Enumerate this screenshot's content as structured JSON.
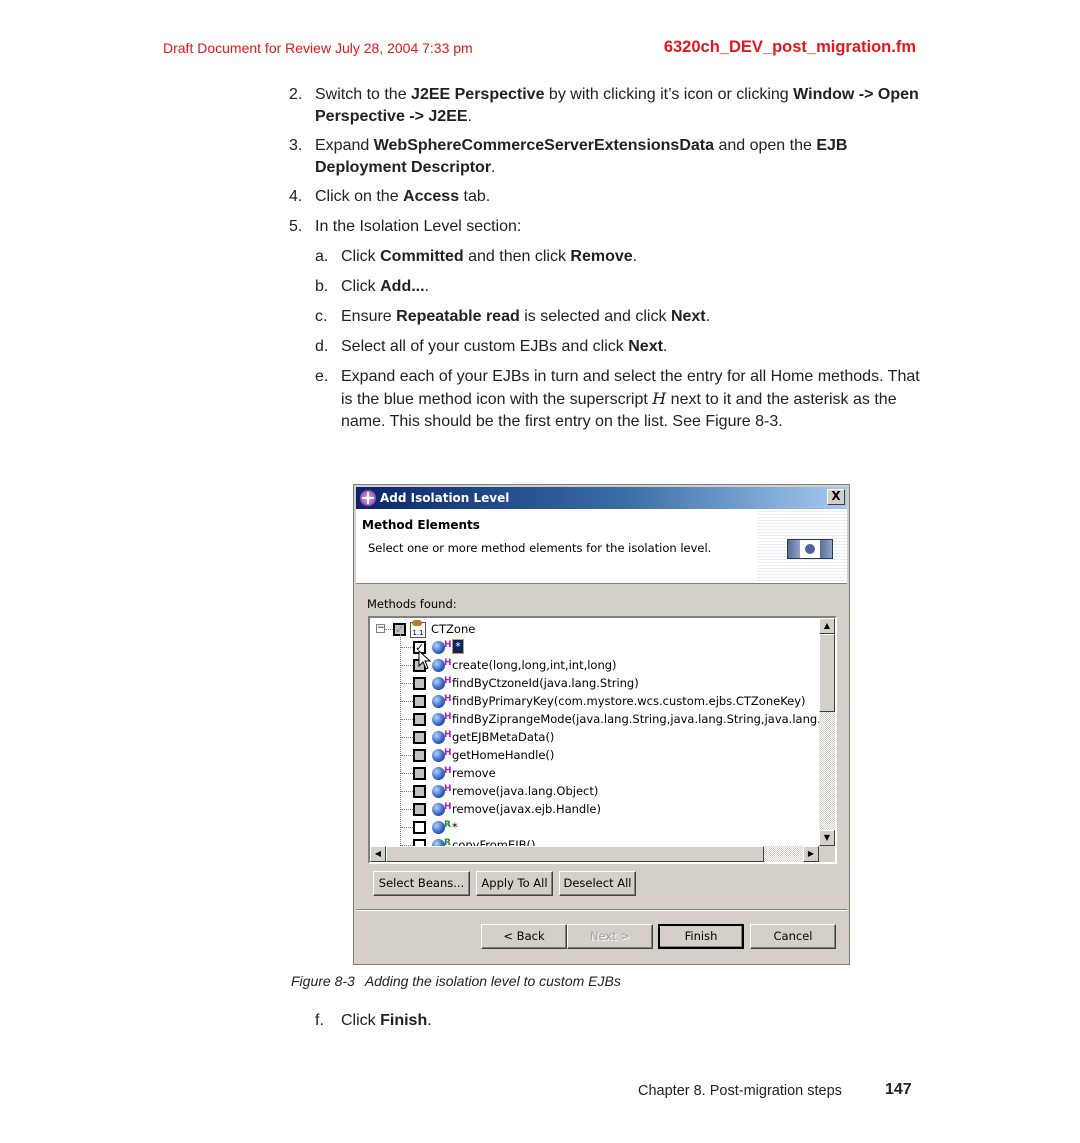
{
  "header": {
    "draft_notice": "Draft Document for Review July 28, 2004 7:33 pm",
    "filename": "6320ch_DEV_post_migration.fm"
  },
  "steps": [
    {
      "num": "2.",
      "parts": [
        {
          "t": "Switch to the ",
          "b": false
        },
        {
          "t": "J2EE Perspective",
          "b": true
        },
        {
          "t": " by with clicking it’s icon or clicking ",
          "b": false
        },
        {
          "t": "Window -> Open Perspective -> J2EE",
          "b": true
        },
        {
          "t": ".",
          "b": false
        }
      ]
    },
    {
      "num": "3.",
      "parts": [
        {
          "t": "Expand ",
          "b": false
        },
        {
          "t": "WebSphereCommerceServerExtensionsData",
          "b": true
        },
        {
          "t": " and open the ",
          "b": false
        },
        {
          "t": "EJB Deployment Descriptor",
          "b": true
        },
        {
          "t": ".",
          "b": false
        }
      ]
    },
    {
      "num": "4.",
      "parts": [
        {
          "t": "Click on the ",
          "b": false
        },
        {
          "t": "Access",
          "b": true
        },
        {
          "t": " tab.",
          "b": false
        }
      ]
    },
    {
      "num": "5.",
      "parts": [
        {
          "t": "In the Isolation Level section:",
          "b": false
        }
      ]
    }
  ],
  "substeps": [
    {
      "num": "a.",
      "parts": [
        {
          "t": "Click ",
          "b": false
        },
        {
          "t": "Committed",
          "b": true
        },
        {
          "t": " and then click ",
          "b": false
        },
        {
          "t": "Remove",
          "b": true
        },
        {
          "t": ".",
          "b": false
        }
      ]
    },
    {
      "num": "b.",
      "parts": [
        {
          "t": "Click ",
          "b": false
        },
        {
          "t": "Add...",
          "b": true
        },
        {
          "t": ".",
          "b": false
        }
      ]
    },
    {
      "num": "c.",
      "parts": [
        {
          "t": "Ensure ",
          "b": false
        },
        {
          "t": "Repeatable read",
          "b": true
        },
        {
          "t": " is selected and click ",
          "b": false
        },
        {
          "t": "Next",
          "b": true
        },
        {
          "t": ".",
          "b": false
        }
      ]
    },
    {
      "num": "d.",
      "parts": [
        {
          "t": "Select all of your custom EJBs and click ",
          "b": false
        },
        {
          "t": "Next",
          "b": true
        },
        {
          "t": ".",
          "b": false
        }
      ]
    },
    {
      "num": "e.",
      "parts": [
        {
          "t": "Expand each of your EJBs in turn and select the entry for all Home methods. That is the blue method icon with the superscript ",
          "b": false
        },
        {
          "t": "H",
          "i": true
        },
        {
          "t": " next to it and the asterisk as the name. This should be the first entry on the list. See Figure 8-3.",
          "b": false
        }
      ]
    }
  ],
  "dialog": {
    "title": "Add Isolation Level",
    "close_label": "X",
    "banner_title": "Method Elements",
    "banner_desc": "Select one or more method elements for the isolation level.",
    "methods_found_label": "Methods found:",
    "tree": {
      "root": {
        "label": "CTZone",
        "icon": "ejb-bean-icon",
        "icon_text": "1.1",
        "state": "grayed-checked",
        "expanded": true
      },
      "items": [
        {
          "label": "*",
          "type": "H",
          "checked": true,
          "selected": true
        },
        {
          "label": "create(long,long,int,int,long)",
          "type": "H",
          "checked": false
        },
        {
          "label": "findByCtzoneId(java.lang.String)",
          "type": "H",
          "checked": false
        },
        {
          "label": "findByPrimaryKey(com.mystore.wcs.custom.ejbs.CTZoneKey)",
          "type": "H",
          "checked": false
        },
        {
          "label": "findByZiprangeMode(java.lang.String,java.lang.String,java.lang.S",
          "type": "H",
          "checked": false
        },
        {
          "label": "getEJBMetaData()",
          "type": "H",
          "checked": false
        },
        {
          "label": "getHomeHandle()",
          "type": "H",
          "checked": false
        },
        {
          "label": "remove",
          "type": "H",
          "checked": false
        },
        {
          "label": "remove(java.lang.Object)",
          "type": "H",
          "checked": false
        },
        {
          "label": "remove(javax.ejb.Handle)",
          "type": "H",
          "checked": false
        },
        {
          "label": "*",
          "type": "R",
          "checked": false
        },
        {
          "label": "copyFromEJB()",
          "type": "R",
          "checked": false
        }
      ]
    },
    "buttons": {
      "select_beans": "Select Beans...",
      "apply_to_all": "Apply To All",
      "deselect_all": "Deselect All",
      "back": "< Back",
      "next": "Next >",
      "finish": "Finish",
      "cancel": "Cancel"
    },
    "colors": {
      "title_start": "#0a246a",
      "title_end": "#a6caf0",
      "face": "#d4d0c8",
      "home_superscript": "#b020c0",
      "remote_superscript": "#209020"
    }
  },
  "figure": {
    "label": "Figure 8-3",
    "caption": "Adding the isolation level to custom EJBs"
  },
  "final_step": {
    "num": "f.",
    "parts": [
      {
        "t": "Click ",
        "b": false
      },
      {
        "t": "Finish",
        "b": true
      },
      {
        "t": ".",
        "b": false
      }
    ]
  },
  "footer": {
    "chapter": "Chapter 8. Post-migration steps",
    "page": "147"
  }
}
